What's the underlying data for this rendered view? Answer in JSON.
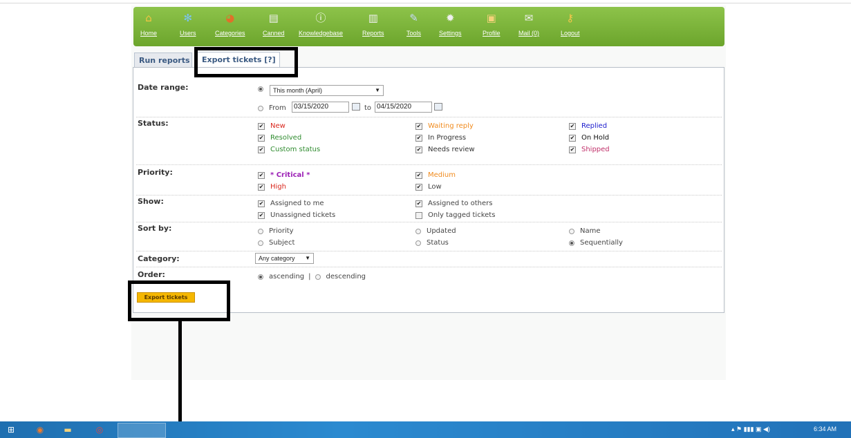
{
  "nav": [
    {
      "label": "Home",
      "icon": "home-icon",
      "glyph": "⌂",
      "color": "#f4c542"
    },
    {
      "label": "Users",
      "icon": "users-icon",
      "glyph": "✻",
      "color": "#7cc3f0"
    },
    {
      "label": "Categories",
      "icon": "categories-pie-icon",
      "glyph": "◕",
      "color": "#e0702a"
    },
    {
      "label": "Canned",
      "icon": "canned-document-icon",
      "glyph": "▤",
      "color": "#f0f0f0"
    },
    {
      "label": "Knowledgebase",
      "icon": "knowledgebase-info-icon",
      "glyph": "ⓘ",
      "color": "#ffffff"
    },
    {
      "label": "Reports",
      "icon": "reports-document-icon",
      "glyph": "▥",
      "color": "#f0f0f0"
    },
    {
      "label": "Tools",
      "icon": "tools-wrench-icon",
      "glyph": "✎",
      "color": "#c8d8ff"
    },
    {
      "label": "Settings",
      "icon": "settings-gear-icon",
      "glyph": "✹",
      "color": "#f0f0f0"
    },
    {
      "label": "Profile",
      "icon": "profile-card-icon",
      "glyph": "▣",
      "color": "#f4d27a"
    },
    {
      "label": "Mail (0)",
      "icon": "mail-icon",
      "glyph": "✉",
      "color": "#f0f0f0"
    },
    {
      "label": "Logout",
      "icon": "logout-key-icon",
      "glyph": "⚷",
      "color": "#f6c64a"
    }
  ],
  "tabs": {
    "run": "Run reports",
    "export": "Export tickets [?]"
  },
  "form": {
    "date_range": {
      "label": "Date range:",
      "preset": "This month (April)",
      "from_label": "From",
      "from_value": "03/15/2020",
      "to_label": "to",
      "to_value": "04/15/2020"
    },
    "status": {
      "label": "Status:",
      "options": [
        {
          "text": "New",
          "color": "#d9261c",
          "checked": true
        },
        {
          "text": "Waiting reply",
          "color": "#f08a1c",
          "checked": true
        },
        {
          "text": "Replied",
          "color": "#1a1acc",
          "checked": true
        },
        {
          "text": "Resolved",
          "color": "#2e8b2e",
          "checked": true
        },
        {
          "text": "In Progress",
          "color": "#333333",
          "checked": true
        },
        {
          "text": "On Hold",
          "color": "#111111",
          "checked": true
        },
        {
          "text": "Custom status",
          "color": "#2e8b2e",
          "checked": true
        },
        {
          "text": "Needs review",
          "color": "#333333",
          "checked": true
        },
        {
          "text": "Shipped",
          "color": "#c0306a",
          "checked": true
        }
      ]
    },
    "priority": {
      "label": "Priority:",
      "options": [
        {
          "text": "* Critical *",
          "color": "#9b1fb5",
          "checked": true
        },
        {
          "text": "Medium",
          "color": "#f08a1c",
          "checked": true
        },
        {
          "text": "High",
          "color": "#d9261c",
          "checked": true
        },
        {
          "text": "Low",
          "color": "#444444",
          "checked": true
        }
      ]
    },
    "show": {
      "label": "Show:",
      "options": [
        {
          "text": "Assigned to me",
          "checked": true
        },
        {
          "text": "Assigned to others",
          "checked": true
        },
        {
          "text": "Unassigned tickets",
          "checked": true
        },
        {
          "text": "Only tagged tickets",
          "checked": false
        }
      ]
    },
    "sort": {
      "label": "Sort by:",
      "options": [
        {
          "text": "Priority",
          "selected": false
        },
        {
          "text": "Updated",
          "selected": false
        },
        {
          "text": "Name",
          "selected": false
        },
        {
          "text": "Subject",
          "selected": false
        },
        {
          "text": "Status",
          "selected": false
        },
        {
          "text": "Sequentially",
          "selected": true
        }
      ]
    },
    "category": {
      "label": "Category:",
      "value": "Any category"
    },
    "order": {
      "label": "Order:",
      "asc": "ascending",
      "sep": "|",
      "desc": "descending"
    },
    "submit": "Export tickets"
  },
  "check_glyph": "✔",
  "taskbar": {
    "clock": "6:34 AM",
    "tray_icons": "▴  ⚑  ▮▮▮  ▣  ◀)"
  }
}
